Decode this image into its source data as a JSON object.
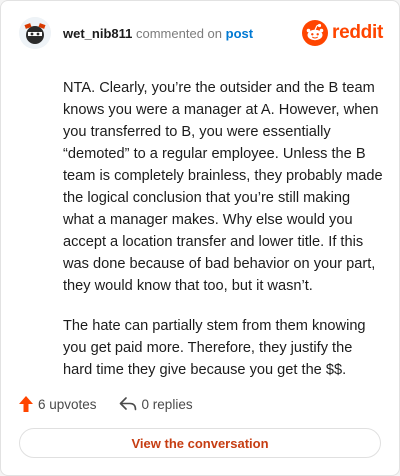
{
  "header": {
    "username": "wet_nib811",
    "action_text": "commented on",
    "post_link": "post",
    "brand": "reddit"
  },
  "comment": {
    "paragraphs": [
      "NTA. Clearly, you’re the outsider and the B team knows you were a manager at A. However, when you transferred to B, you were essentially “demoted” to a regular employee. Unless the B team is completely brainless, they probably made the logical conclusion that you’re still making what a manager makes. Why else would you accept a location transfer and lower title. If this was done because of bad behavior on your part, they would know that too, but it wasn’t.",
      "The hate can partially stem from them knowing you get paid more. Therefore, they justify the hard time they give because you get the $$."
    ]
  },
  "stats": {
    "upvotes": "6 upvotes",
    "replies": "0 replies"
  },
  "cta": {
    "label": "View the conversation"
  },
  "colors": {
    "brand": "#ff4500",
    "link": "#0079d3",
    "cta_text": "#c63d12"
  }
}
